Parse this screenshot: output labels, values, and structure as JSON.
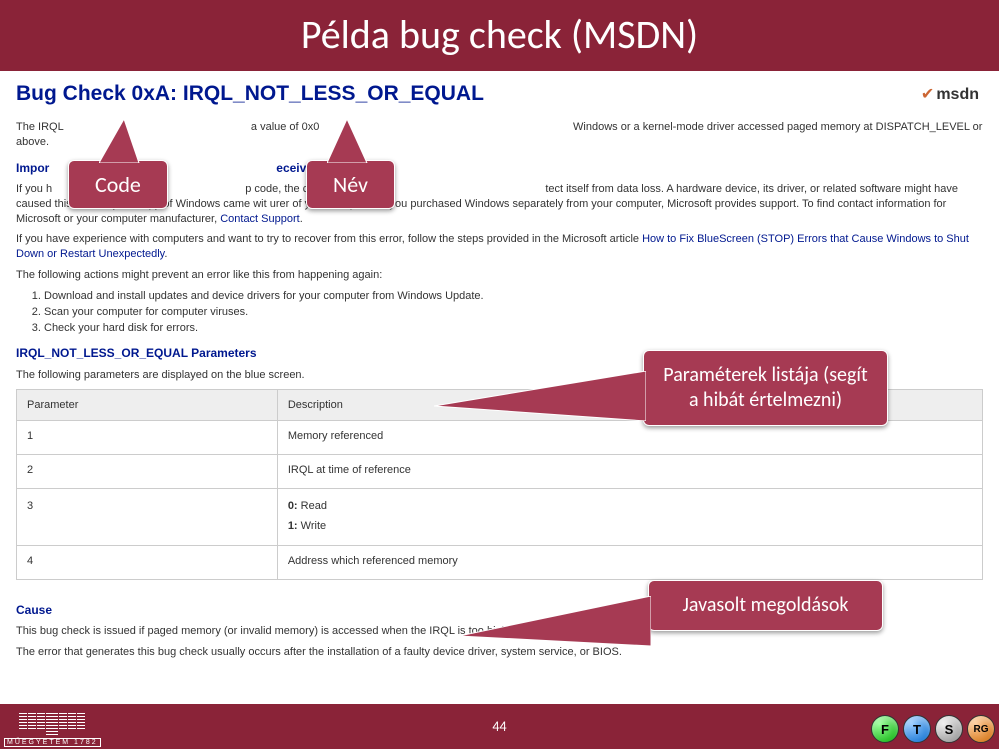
{
  "slide": {
    "title": "Példa bug check (MSDN)",
    "page_number": "44"
  },
  "logo": {
    "text": "msdn"
  },
  "article": {
    "heading": "Bug Check 0xA: IRQL_NOT_LESS_OR_EQUAL",
    "intro_prefix": "The IRQL",
    "intro_mid": "a value of 0x0",
    "intro_suffix": "Windows or a kernel-mode driver accessed paged memory at DISPATCH_LEVEL or above.",
    "important_heading_prefix": "Impor",
    "important_heading_suffix": "eceived a STO",
    "important_text_prefix": "If you h",
    "important_text_mid": "p code, the c",
    "important_text_suffix": "tect itself from data loss. A hardware device, its driver, or related software might have caused this error. If your copy of Windows came wit",
    "important_text_line2": "urer of your computer. If you purchased Windows separately from your computer, Microsoft provides support. To find contact information for Microsoft or your computer manufacturer,",
    "contact_support": "Contact Support",
    "dot": ".",
    "experience_line_prefix": "If you have experience with computers and want to try to recover from this error, follow the steps provided in the Microsoft article ",
    "experience_link": "How to Fix BlueScreen (STOP) Errors that Cause Windows to Shut Down or Restart Unexpectedly",
    "prevent_line": "The following actions might prevent an error like this from happening again:",
    "steps": [
      "Download and install updates and device drivers for your computer from Windows Update.",
      "Scan your computer for computer viruses.",
      "Check your hard disk for errors."
    ],
    "params_heading": "IRQL_NOT_LESS_OR_EQUAL Parameters",
    "params_intro": "The following parameters are displayed on the blue screen.",
    "table": {
      "col1": "Parameter",
      "col2": "Description",
      "rows": [
        {
          "p": "1",
          "d": "Memory referenced"
        },
        {
          "p": "2",
          "d": "IRQL at time of reference"
        },
        {
          "p": "3",
          "d0": "0:",
          "d0t": " Read",
          "d1": "1:",
          "d1t": " Write"
        },
        {
          "p": "4",
          "d": "Address which referenced memory"
        }
      ]
    },
    "cause_heading": "Cause",
    "cause_text1": "This bug check is issued if paged memory (or invalid memory) is accessed when the IRQL is too high.",
    "cause_text2": "The error that generates this bug check usually occurs after the installation of a faulty device driver, system service, or BIOS."
  },
  "callouts": {
    "code": "Code",
    "name": "Név",
    "params": "Paraméterek listája (segít a hibát értelmezni)",
    "solutions": "Javasolt megoldások"
  },
  "footer_badges": {
    "f": "F",
    "t": "T",
    "s": "S",
    "rg": "RG"
  },
  "bme_text": "MŰEGYETEM 1782"
}
